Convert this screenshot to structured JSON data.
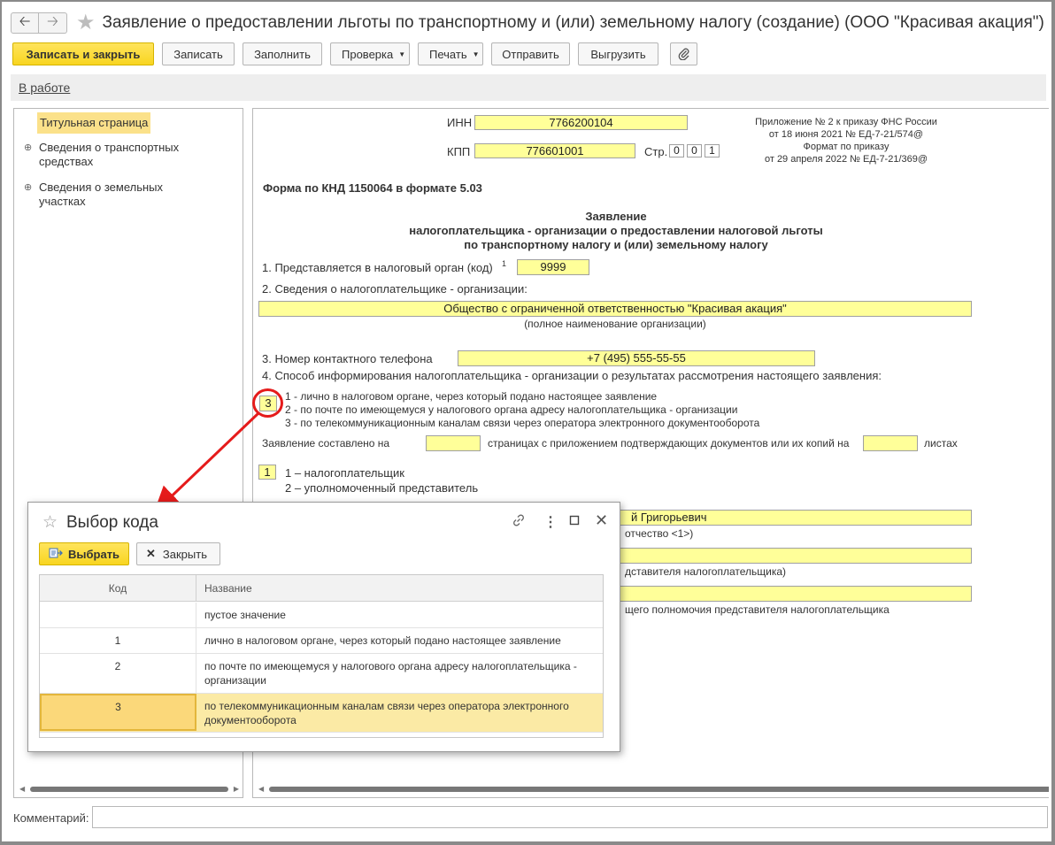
{
  "window": {
    "title": "Заявление о предоставлении льготы по транспортному и (или) земельному налогу (создание) (ООО \"Красивая акация\")"
  },
  "toolbar": {
    "save_close": "Записать и закрыть",
    "save": "Записать",
    "fill": "Заполнить",
    "check": "Проверка",
    "print": "Печать",
    "send": "Отправить",
    "export": "Выгрузить"
  },
  "status": {
    "link": "В работе"
  },
  "sidebar": {
    "items": [
      {
        "label": "Титульная страница"
      },
      {
        "label": "Сведения о транспортных средствах"
      },
      {
        "label": "Сведения о земельных участках"
      }
    ]
  },
  "form": {
    "inn_label": "ИНН",
    "inn": "7766200104",
    "kpp_label": "КПП",
    "kpp": "776601001",
    "page_label": "Стр.",
    "page_digits": [
      "0",
      "0",
      "1"
    ],
    "appendix": [
      "Приложение № 2 к приказу ФНС России",
      "от 18 июня 2021 № ЕД-7-21/574@",
      "Формат по приказу",
      "от 29 апреля 2022 № ЕД-7-21/369@"
    ],
    "knd": "Форма по КНД 1150064 в формате 5.03",
    "heading": [
      "Заявление",
      "налогоплательщика - организации о предоставлении налоговой льготы",
      "по транспортному налогу и (или) земельному налогу"
    ],
    "item1_label": "1. Представляется в налоговый орган (код)",
    "item1_sup": "1",
    "item1_value": "9999",
    "item2_label": "2. Сведения о налогоплательщике - организации:",
    "org_name": "Общество с ограниченной ответственностью \"Красивая акация\"",
    "org_name_caption": "(полное наименование организации)",
    "item3_label": "3. Номер контактного телефона",
    "phone": "+7 (495) 555-55-55",
    "item4_label": "4. Способ информирования налогоплательщика - организации о результатах рассмотрения настоящего заявления:",
    "item4_value": "3",
    "item4_options": [
      "1 - лично в налоговом органе, через который подано настоящее заявление",
      "2 - по почте по имеющемуся у налогового органа адресу налогоплательщика - организации",
      "3 - по телекоммуникационным каналам связи через оператора электронного документооборота"
    ],
    "pages_prefix": "Заявление составлено на",
    "pages_mid": "страницах с приложением подтверждающих документов или их копий на",
    "pages_suffix": "листах",
    "signer_value": "1",
    "signer_options": [
      "1 – налогоплательщик",
      "2 – уполномоченный представитель"
    ],
    "fio_partial": "й Григорьевич",
    "fio_caption_partial": "отчество <1>)",
    "rep_caption_partial": "дставителя налогоплательщика)",
    "doc_caption_partial": "щего полномочия представителя налогоплательщика"
  },
  "comment": {
    "label": "Комментарий:"
  },
  "dialog": {
    "title": "Выбор кода",
    "select_btn": "Выбрать",
    "close_btn": "Закрыть",
    "col_code": "Код",
    "col_name": "Название",
    "rows": [
      {
        "code": "",
        "name": "пустое значение"
      },
      {
        "code": "1",
        "name": "лично в налоговом органе, через который подано настоящее заявление"
      },
      {
        "code": "2",
        "name": "по почте по имеющемуся у налогового органа адресу налогоплательщика - организации"
      },
      {
        "code": "3",
        "name": "по телекоммуникационным каналам связи через оператора электронного документооборота"
      }
    ]
  },
  "colors": {
    "accent_yellow": "#f8d520",
    "field_yellow": "#ffff99",
    "selection": "#fbeaa5",
    "annotation_red": "#e51b1b"
  }
}
